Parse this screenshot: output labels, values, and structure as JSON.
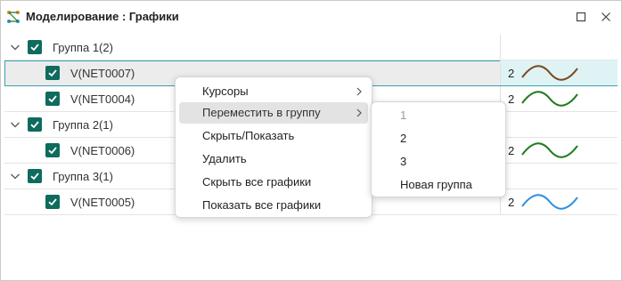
{
  "window": {
    "title": "Моделирование : Графики"
  },
  "tree": {
    "rows": [
      {
        "type": "group",
        "label": "Группа 1(2)"
      },
      {
        "type": "signal",
        "label": "V(NET0007)",
        "thumb": {
          "num": "2",
          "color": "#7a4a1e"
        }
      },
      {
        "type": "signal",
        "label": "V(NET0004)",
        "thumb": {
          "num": "2",
          "color": "#1f7a1f"
        }
      },
      {
        "type": "group",
        "label": "Группа 2(1)"
      },
      {
        "type": "signal",
        "label": "V(NET0006)",
        "thumb": {
          "num": "2",
          "color": "#1f7a1f"
        }
      },
      {
        "type": "group",
        "label": "Группа 3(1)"
      },
      {
        "type": "signal",
        "label": "V(NET0005)",
        "thumb": {
          "num": "2",
          "color": "#2f8fe0"
        }
      }
    ]
  },
  "context_menu": {
    "items": [
      {
        "label": "Курсоры",
        "has_submenu": true
      },
      {
        "label": "Переместить в группу",
        "has_submenu": true,
        "highlighted": true
      },
      {
        "label": "Скрыть/Показать"
      },
      {
        "label": "Удалить"
      },
      {
        "label": "Скрыть все графики"
      },
      {
        "label": "Показать все графики"
      }
    ]
  },
  "submenu": {
    "items": [
      {
        "label": "1",
        "disabled": true
      },
      {
        "label": "2"
      },
      {
        "label": "3"
      },
      {
        "label": "Новая группа"
      }
    ]
  },
  "colors": {
    "accent": "#0f6b5e",
    "selection_border": "#3aa1b0"
  }
}
